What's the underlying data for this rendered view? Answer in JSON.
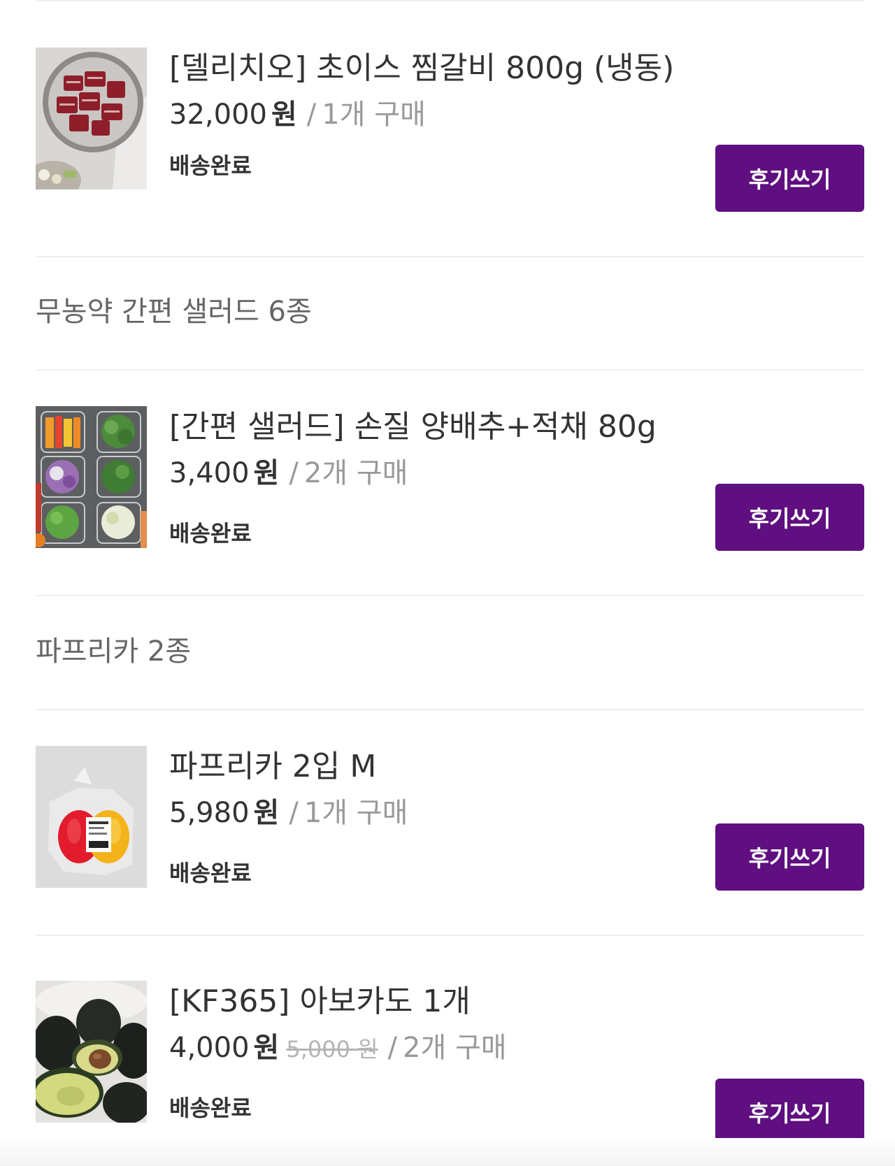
{
  "items": [
    {
      "name": "[델리치오] 초이스 찜갈비 800g (냉동)",
      "price": "32,000",
      "currency": "원",
      "original_price": "",
      "separator": "/",
      "qty": "1개 구매",
      "status": "배송완료",
      "button": "후기쓰기",
      "image": "short-ribs"
    },
    {
      "name": "[간편 샐러드] 손질 양배추+적채 80g",
      "price": "3,400",
      "currency": "원",
      "original_price": "",
      "separator": "/",
      "qty": "2개 구매",
      "status": "배송완료",
      "button": "후기쓰기",
      "image": "salad-containers"
    },
    {
      "name": "파프리카 2입 M",
      "price": "5,980",
      "currency": "원",
      "original_price": "",
      "separator": "/",
      "qty": "1개 구매",
      "status": "배송완료",
      "button": "후기쓰기",
      "image": "paprika-bag"
    },
    {
      "name": "[KF365] 아보카도 1개",
      "price": "4,000",
      "currency": "원",
      "original_price": "5,000 원",
      "separator": "/",
      "qty": "2개 구매",
      "status": "배송완료",
      "button": "후기쓰기",
      "image": "avocado"
    }
  ],
  "groups": [
    {
      "title": "무농약 간편 샐러드 6종"
    },
    {
      "title": "파프리카 2종"
    }
  ],
  "colors": {
    "accent": "#5f0f80",
    "text": "#333333",
    "muted": "#999999",
    "divider": "#eeeeee"
  }
}
